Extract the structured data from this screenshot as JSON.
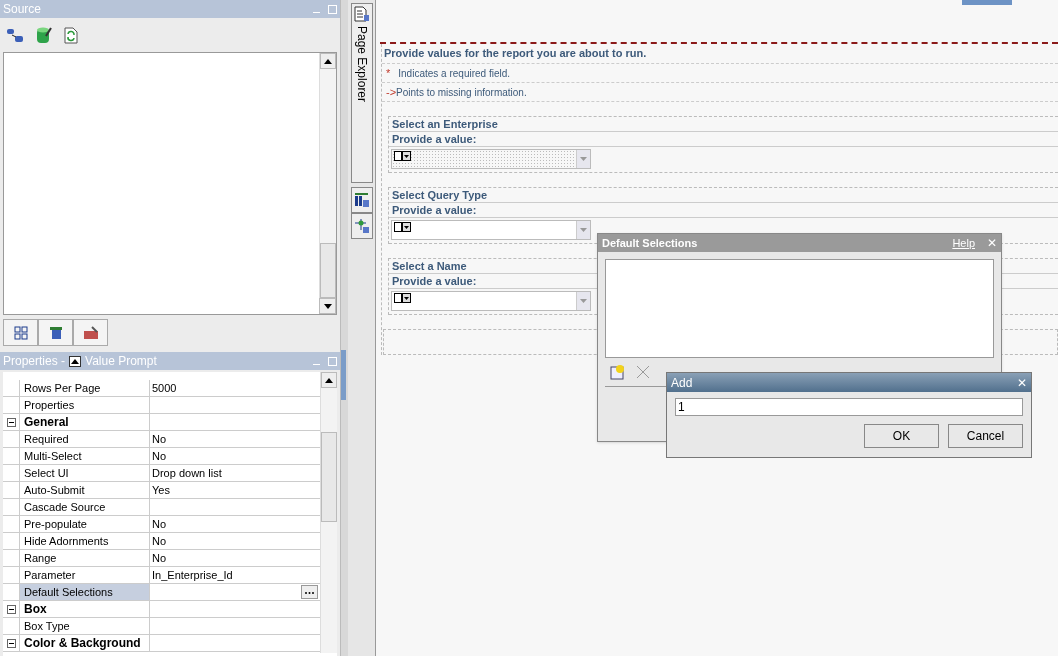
{
  "source_panel": {
    "title": "Source"
  },
  "properties_panel": {
    "title_prefix": "Properties - ",
    "title": "Value Prompt",
    "rows": [
      {
        "kind": "row",
        "name": "Rows Per Page",
        "value": "5000",
        "selected": false
      },
      {
        "kind": "row",
        "name": "Properties",
        "value": "",
        "selected": false
      },
      {
        "kind": "group",
        "name": "General",
        "expanded": true
      },
      {
        "kind": "row",
        "name": "Required",
        "value": "No",
        "selected": false
      },
      {
        "kind": "row",
        "name": "Multi-Select",
        "value": "No",
        "selected": false
      },
      {
        "kind": "row",
        "name": "Select UI",
        "value": "Drop down list",
        "selected": false
      },
      {
        "kind": "row",
        "name": "Auto-Submit",
        "value": "Yes",
        "selected": false
      },
      {
        "kind": "row",
        "name": "Cascade Source",
        "value": "",
        "selected": false
      },
      {
        "kind": "row",
        "name": "Pre-populate",
        "value": "No",
        "selected": false
      },
      {
        "kind": "row",
        "name": "Hide Adornments",
        "value": "No",
        "selected": false
      },
      {
        "kind": "row",
        "name": "Range",
        "value": "No",
        "selected": false
      },
      {
        "kind": "row",
        "name": "Parameter",
        "value": "In_Enterprise_Id",
        "selected": false
      },
      {
        "kind": "row",
        "name": "Default Selections",
        "value": "",
        "selected": true
      },
      {
        "kind": "group",
        "name": "Box",
        "expanded": true
      },
      {
        "kind": "row",
        "name": "Box Type",
        "value": "",
        "selected": false
      },
      {
        "kind": "group",
        "name": "Color & Background",
        "expanded": true
      }
    ]
  },
  "side_tab": {
    "label": "Page Explorer"
  },
  "canvas": {
    "heading": "Provide values for the report you are about to run.",
    "required_mark": "*",
    "required_note": "Indicates a required field.",
    "missing_mark": "->",
    "missing_note": "Points to missing information.",
    "prompts": [
      {
        "title": "Select an Enterprise",
        "hint": "Provide a value:",
        "selected": true
      },
      {
        "title": "Select Query Type",
        "hint": "Provide a value:",
        "selected": false
      },
      {
        "title": "Select a Name",
        "hint": "Provide a value:",
        "selected": false
      }
    ]
  },
  "default_selections_dialog": {
    "title": "Default Selections",
    "help": "Help",
    "close": "✕"
  },
  "add_dialog": {
    "title": "Add",
    "close": "✕",
    "value": "1",
    "buttons": [
      "OK",
      "Cancel"
    ]
  }
}
